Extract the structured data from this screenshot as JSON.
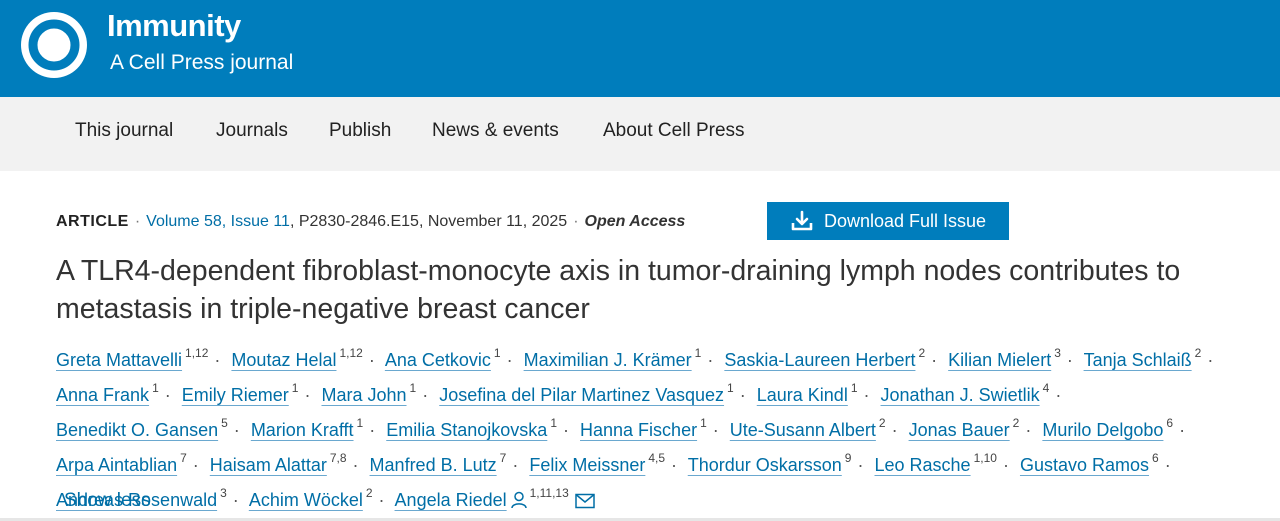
{
  "header": {
    "journal_name": "Immunity",
    "journal_subtitle": "A Cell Press journal",
    "logo_icon": "cell-press-logo"
  },
  "nav": {
    "items": [
      "This journal",
      "Journals",
      "Publish",
      "News & events",
      "About Cell Press"
    ]
  },
  "article": {
    "type": "ARTICLE",
    "volume_issue": "Volume 58, Issue 11",
    "pages": "P2830-2846.E15",
    "date": "November 11, 2025",
    "access": "Open Access",
    "download_label": "Download Full Issue",
    "title": "A TLR4-dependent fibroblast-monocyte axis in tumor-draining lymph nodes contributes to metastasis in triple-negative breast cancer",
    "authors": [
      {
        "name": "Greta Mattavelli",
        "aff": "1,12"
      },
      {
        "name": "Moutaz Helal",
        "aff": "1,12"
      },
      {
        "name": "Ana Cetkovic",
        "aff": "1"
      },
      {
        "name": "Maximilian J. Krämer",
        "aff": "1"
      },
      {
        "name": "Saskia-Laureen Herbert",
        "aff": "2"
      },
      {
        "name": "Kilian Mielert",
        "aff": "3"
      },
      {
        "name": "Tanja Schlaiß",
        "aff": "2"
      },
      {
        "name": "Anna Frank",
        "aff": "1"
      },
      {
        "name": "Emily Riemer",
        "aff": "1"
      },
      {
        "name": "Mara John",
        "aff": "1"
      },
      {
        "name": "Josefina del Pilar Martinez Vasquez",
        "aff": "1"
      },
      {
        "name": "Laura Kindl",
        "aff": "1"
      },
      {
        "name": "Jonathan J. Swietlik",
        "aff": "4"
      },
      {
        "name": "Benedikt O. Gansen",
        "aff": "5"
      },
      {
        "name": "Marion Krafft",
        "aff": "1"
      },
      {
        "name": "Emilia Stanojkovska",
        "aff": "1"
      },
      {
        "name": "Hanna Fischer",
        "aff": "1"
      },
      {
        "name": "Ute-Susann Albert",
        "aff": "2"
      },
      {
        "name": "Jonas Bauer",
        "aff": "2"
      },
      {
        "name": "Murilo Delgobo",
        "aff": "6"
      },
      {
        "name": "Arpa Aintablian",
        "aff": "7"
      },
      {
        "name": "Haisam Alattar",
        "aff": "7,8"
      },
      {
        "name": "Manfred B. Lutz",
        "aff": "7"
      },
      {
        "name": "Felix Meissner",
        "aff": "4,5"
      },
      {
        "name": "Thordur Oskarsson",
        "aff": "9"
      },
      {
        "name": "Leo Rasche",
        "aff": "1,10"
      },
      {
        "name": "Gustavo Ramos",
        "aff": "6"
      },
      {
        "name": "Andreas Rosenwald",
        "aff": "3"
      },
      {
        "name": "Achim Wöckel",
        "aff": "2"
      },
      {
        "name": "Angela Riedel",
        "aff": "1,11,13",
        "corresponding": true
      }
    ],
    "show_less": "Show less"
  },
  "colors": {
    "brand_blue": "#007dbc",
    "link_blue": "#006ea6",
    "nav_bg": "#f2f2f2"
  }
}
